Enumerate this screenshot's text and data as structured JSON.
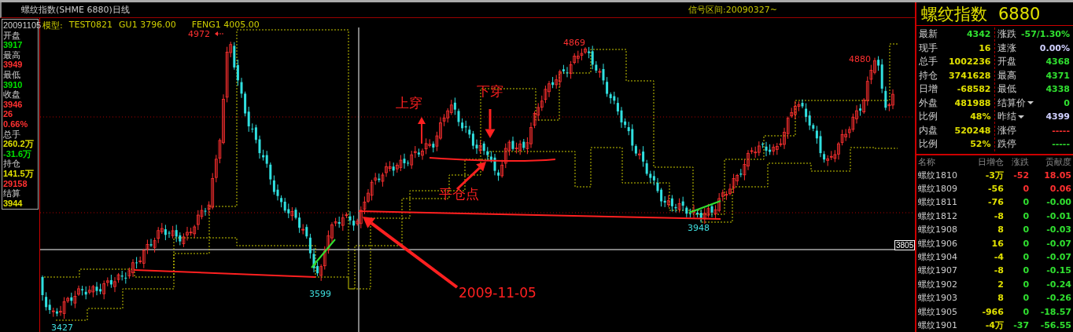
{
  "title": "螺纹指数(SHME 6880)日线",
  "signal_range": "信号区间:20090327~",
  "model": {
    "label": "模型:",
    "name": "TEST0821",
    "gu": "GU1 3796.00",
    "feng": "FENG1 4005.00"
  },
  "info": {
    "date": "20091105",
    "items": [
      {
        "kind": "label",
        "text": "开盘"
      },
      {
        "kind": "value",
        "text": "3917",
        "color": "#00e000"
      },
      {
        "kind": "label",
        "text": "最高"
      },
      {
        "kind": "value",
        "text": "3949",
        "color": "#ff3030"
      },
      {
        "kind": "label",
        "text": "最低"
      },
      {
        "kind": "value",
        "text": "3910",
        "color": "#00e000"
      },
      {
        "kind": "label",
        "text": "收盘"
      },
      {
        "kind": "value",
        "text": "3946",
        "color": "#ff3030"
      },
      {
        "kind": "value",
        "text": "26",
        "color": "#ff3030"
      },
      {
        "kind": "value",
        "text": "0.66%",
        "color": "#ff3030"
      },
      {
        "kind": "label",
        "text": "总手"
      },
      {
        "kind": "value",
        "text": "260.2万",
        "color": "#e0e000"
      },
      {
        "kind": "value",
        "text": "-31.6万",
        "color": "#00e000"
      },
      {
        "kind": "label",
        "text": "持仓"
      },
      {
        "kind": "value",
        "text": "141.5万",
        "color": "#e0e000"
      },
      {
        "kind": "value",
        "text": "29158",
        "color": "#ff3030"
      },
      {
        "kind": "label",
        "text": "结算"
      },
      {
        "kind": "value",
        "text": "3944",
        "color": "#e0e000"
      }
    ]
  },
  "annotations": [
    {
      "kind": "price",
      "text": "4972",
      "color": "#ff3030"
    },
    {
      "kind": "price",
      "text": "4869",
      "color": "#ff3030"
    },
    {
      "kind": "price",
      "text": "4880",
      "color": "#ff3030"
    },
    {
      "kind": "price",
      "text": "3599",
      "color": "#40e0e0"
    },
    {
      "kind": "price",
      "text": "3948",
      "color": "#40e0e0"
    },
    {
      "kind": "price",
      "text": "3427",
      "color": "#40e0e0"
    },
    {
      "kind": "note",
      "text": "上穿",
      "color": "#ff2020"
    },
    {
      "kind": "note",
      "text": "下穿",
      "color": "#ff2020"
    },
    {
      "kind": "note",
      "text": "平仓点",
      "color": "#ff2020"
    },
    {
      "kind": "note",
      "text": "2009-11-05",
      "color": "#ff2020"
    },
    {
      "kind": "axis",
      "text": "3805",
      "color": "#ffffff"
    }
  ],
  "quote": {
    "name": "螺纹指数",
    "code": "6880",
    "left": [
      {
        "kind": "plain",
        "label": "最新",
        "value": "4342",
        "color": "#30e030"
      },
      {
        "kind": "plain",
        "label": "现手",
        "value": "16",
        "color": "#e0e000"
      },
      {
        "kind": "plain",
        "label": "总手",
        "value": "1002236",
        "color": "#e0e000"
      },
      {
        "kind": "plain",
        "label": "持仓",
        "value": "3741628",
        "color": "#e0e000"
      },
      {
        "kind": "plain",
        "label": "日增",
        "value": "-68582",
        "color": "#e0e000"
      },
      {
        "kind": "plain",
        "label": "外盘",
        "value": "481988",
        "color": "#e0e000"
      },
      {
        "kind": "plain",
        "label": "比例",
        "value": "48%",
        "color": "#e0e000"
      },
      {
        "kind": "plain",
        "label": "内盘",
        "value": "520248",
        "color": "#e0e000"
      },
      {
        "kind": "plain",
        "label": "比例",
        "value": "52%",
        "color": "#e0e000"
      }
    ],
    "right": [
      {
        "kind": "plain",
        "label": "涨跌",
        "value": "-57/1.30%",
        "color": "#30e030"
      },
      {
        "kind": "plain",
        "label": "速涨",
        "value": "0.00%",
        "color": "#d0d0ff"
      },
      {
        "kind": "plain",
        "label": "开盘",
        "value": "4368",
        "color": "#30e030"
      },
      {
        "kind": "plain",
        "label": "最高",
        "value": "4371",
        "color": "#30e030"
      },
      {
        "kind": "plain",
        "label": "最低",
        "value": "4338",
        "color": "#30e030"
      },
      {
        "kind": "dropdown",
        "label": "结算价",
        "value": "0",
        "color": "#30e030"
      },
      {
        "kind": "dropdown",
        "label": "昨结",
        "value": "4399",
        "color": "#d0d0ff"
      },
      {
        "kind": "plain",
        "label": "涨停",
        "value": "-----",
        "color": "#ff3030"
      },
      {
        "kind": "plain",
        "label": "跌停",
        "value": "-----",
        "color": "#30e030"
      }
    ]
  },
  "contracts": {
    "columns": [
      "名称",
      "日增仓",
      "涨跌",
      "贡献度"
    ],
    "rows": [
      {
        "name": "螺纹1810",
        "change_oi": "-3万",
        "change": "-52",
        "contribution": "18.05",
        "color": "#ff3030"
      },
      {
        "name": "螺纹1809",
        "change_oi": "-56",
        "change": "0",
        "contribution": "0.06",
        "color": "#ff3030"
      },
      {
        "name": "螺纹1811",
        "change_oi": "-76",
        "change": "0",
        "contribution": "-0.00",
        "color": "#30e030"
      },
      {
        "name": "螺纹1812",
        "change_oi": "-8",
        "change": "0",
        "contribution": "-0.01",
        "color": "#30e030"
      },
      {
        "name": "螺纹1908",
        "change_oi": "8",
        "change": "0",
        "contribution": "-0.03",
        "color": "#30e030"
      },
      {
        "name": "螺纹1906",
        "change_oi": "16",
        "change": "0",
        "contribution": "-0.07",
        "color": "#30e030"
      },
      {
        "name": "螺纹1904",
        "change_oi": "-4",
        "change": "0",
        "contribution": "-0.07",
        "color": "#30e030"
      },
      {
        "name": "螺纹1907",
        "change_oi": "-8",
        "change": "0",
        "contribution": "-0.15",
        "color": "#30e030"
      },
      {
        "name": "螺纹1902",
        "change_oi": "2",
        "change": "0",
        "contribution": "-0.24",
        "color": "#30e030"
      },
      {
        "name": "螺纹1903",
        "change_oi": "8",
        "change": "0",
        "contribution": "-0.26",
        "color": "#30e030"
      },
      {
        "name": "螺纹1905",
        "change_oi": "-966",
        "change": "0",
        "contribution": "-18.57",
        "color": "#30e030"
      },
      {
        "name": "螺纹1901",
        "change_oi": "-4万",
        "change": "-37",
        "contribution": "-56.55",
        "color": "#30e030"
      }
    ]
  }
}
